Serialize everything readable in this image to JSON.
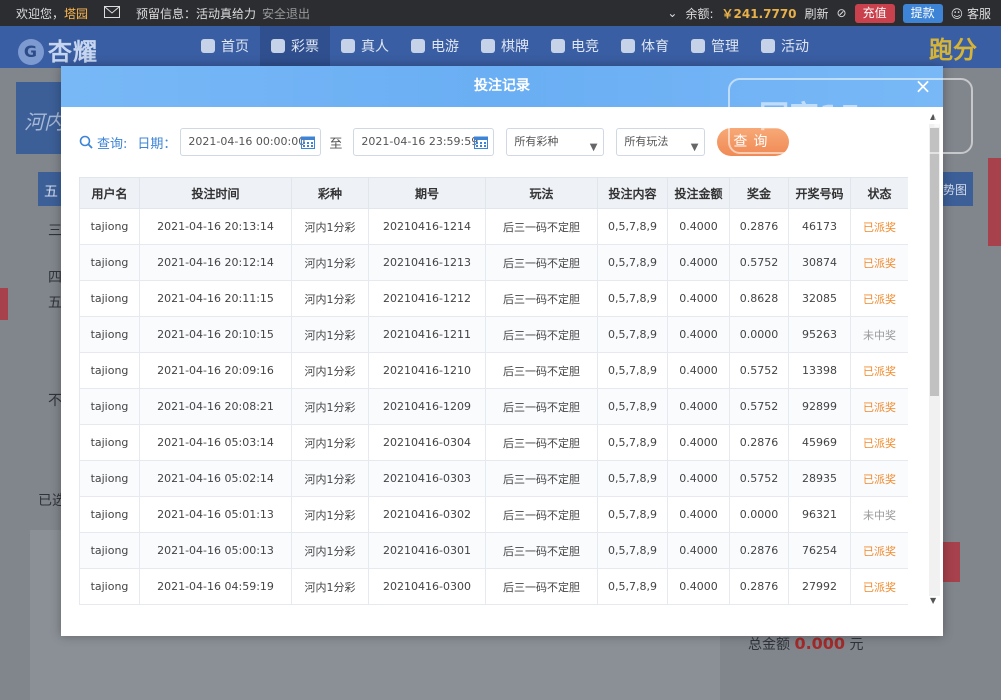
{
  "topbar": {
    "welcome": "欢迎您，",
    "username": "塔园",
    "notice_label": "预留信息：活动真给力",
    "logout": "安全退出",
    "balance_label": "余额:",
    "balance_value": "￥241.7770",
    "refresh": "刷新",
    "recharge": "充值",
    "withdraw": "提款",
    "service": "客服"
  },
  "nav": {
    "logo": "杏耀",
    "items": [
      {
        "label": "首页"
      },
      {
        "label": "彩票"
      },
      {
        "label": "真人"
      },
      {
        "label": "电游"
      },
      {
        "label": "棋牌"
      },
      {
        "label": "电竞"
      },
      {
        "label": "体育"
      },
      {
        "label": "管理"
      },
      {
        "label": "活动"
      }
    ],
    "right_text": "跑分"
  },
  "background": {
    "left_title": "河内",
    "side_tab": "五",
    "row1": "三",
    "row2": "四",
    "row3": "五",
    "text4": "不",
    "text5": "已选",
    "right_tab": "势图",
    "total_label": "总金额",
    "total_value": "0.000",
    "total_unit": "元"
  },
  "modal": {
    "title": "投注记录",
    "close_glyph": "×",
    "query_label": "查询:",
    "date_label": "日期：",
    "start_date": "2021-04-16 00:00:00",
    "to_label": "至",
    "end_date": "2021-04-16 23:59:59",
    "lottery_select": "所有彩种",
    "play_select": "所有玩法",
    "query_button": "查询"
  },
  "table": {
    "headers": [
      "用户名",
      "投注时间",
      "彩种",
      "期号",
      "玩法",
      "投注内容",
      "投注金额",
      "奖金",
      "开奖号码",
      "状态"
    ],
    "rows": [
      [
        "tajiong",
        "2021-04-16 20:13:14",
        "河内1分彩",
        "20210416-1214",
        "后三一码不定胆",
        "0,5,7,8,9",
        "0.4000",
        "0.2876",
        "46173",
        "已派奖"
      ],
      [
        "tajiong",
        "2021-04-16 20:12:14",
        "河内1分彩",
        "20210416-1213",
        "后三一码不定胆",
        "0,5,7,8,9",
        "0.4000",
        "0.5752",
        "30874",
        "已派奖"
      ],
      [
        "tajiong",
        "2021-04-16 20:11:15",
        "河内1分彩",
        "20210416-1212",
        "后三一码不定胆",
        "0,5,7,8,9",
        "0.4000",
        "0.8628",
        "32085",
        "已派奖"
      ],
      [
        "tajiong",
        "2021-04-16 20:10:15",
        "河内1分彩",
        "20210416-1211",
        "后三一码不定胆",
        "0,5,7,8,9",
        "0.4000",
        "0.0000",
        "95263",
        "未中奖"
      ],
      [
        "tajiong",
        "2021-04-16 20:09:16",
        "河内1分彩",
        "20210416-1210",
        "后三一码不定胆",
        "0,5,7,8,9",
        "0.4000",
        "0.5752",
        "13398",
        "已派奖"
      ],
      [
        "tajiong",
        "2021-04-16 20:08:21",
        "河内1分彩",
        "20210416-1209",
        "后三一码不定胆",
        "0,5,7,8,9",
        "0.4000",
        "0.5752",
        "92899",
        "已派奖"
      ],
      [
        "tajiong",
        "2021-04-16 05:03:14",
        "河内1分彩",
        "20210416-0304",
        "后三一码不定胆",
        "0,5,7,8,9",
        "0.4000",
        "0.2876",
        "45969",
        "已派奖"
      ],
      [
        "tajiong",
        "2021-04-16 05:02:14",
        "河内1分彩",
        "20210416-0303",
        "后三一码不定胆",
        "0,5,7,8,9",
        "0.4000",
        "0.5752",
        "28935",
        "已派奖"
      ],
      [
        "tajiong",
        "2021-04-16 05:01:13",
        "河内1分彩",
        "20210416-0302",
        "后三一码不定胆",
        "0,5,7,8,9",
        "0.4000",
        "0.0000",
        "96321",
        "未中奖"
      ],
      [
        "tajiong",
        "2021-04-16 05:00:13",
        "河内1分彩",
        "20210416-0301",
        "后三一码不定胆",
        "0,5,7,8,9",
        "0.4000",
        "0.2876",
        "76254",
        "已派奖"
      ],
      [
        "tajiong",
        "2021-04-16 04:59:19",
        "河内1分彩",
        "20210416-0300",
        "后三一码不定胆",
        "0,5,7,8,9",
        "0.4000",
        "0.2876",
        "27992",
        "已派奖"
      ]
    ]
  },
  "watermark": "回家15.com",
  "colors": {
    "header_blue": "#6aaef3",
    "accent_blue": "#3d84d6",
    "status_paid": "#f08a2c",
    "status_none": "#999999",
    "query_btn": "#f08a55"
  }
}
